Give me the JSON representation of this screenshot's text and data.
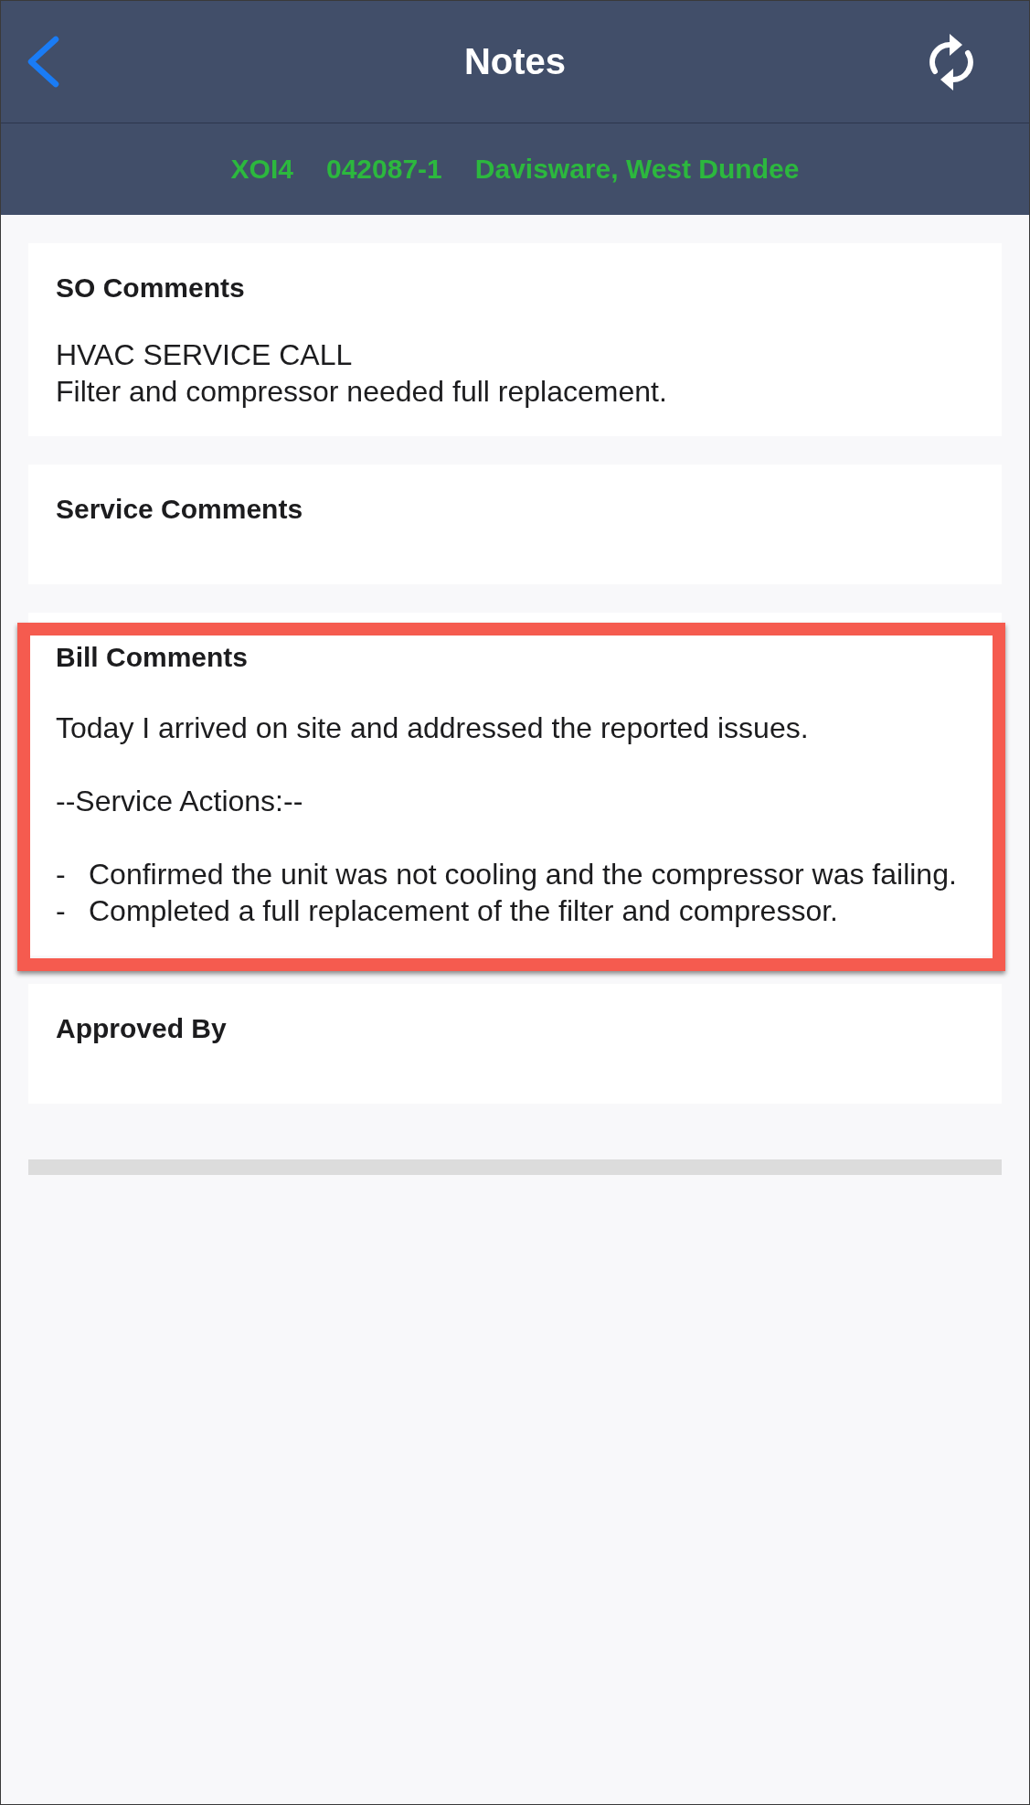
{
  "header": {
    "title": "Notes"
  },
  "info_bar": {
    "items": [
      "XOI4",
      "042087-1",
      "Davisware, West Dundee"
    ]
  },
  "cards": [
    {
      "title": "SO Comments",
      "highlighted": false,
      "body": [
        {
          "kind": "lines",
          "lines": [
            "HVAC SERVICE CALL",
            "Filter and compressor needed full replacement."
          ]
        }
      ]
    },
    {
      "title": "Service Comments",
      "highlighted": false
    },
    {
      "title": "Bill Comments",
      "highlighted": true,
      "body": [
        {
          "kind": "paragraph",
          "text": "Today I arrived on site and addressed the reported issues."
        },
        {
          "kind": "paragraph",
          "text": "--Service Actions:--"
        },
        {
          "kind": "list",
          "items": [
            {
              "marker": "-",
              "text": "Confirmed the unit was not cooling and the compressor was failing."
            },
            {
              "marker": "-",
              "text": "Completed a full replacement of the filter and compressor."
            }
          ]
        }
      ]
    },
    {
      "title": "Approved By",
      "highlighted": false
    }
  ]
}
